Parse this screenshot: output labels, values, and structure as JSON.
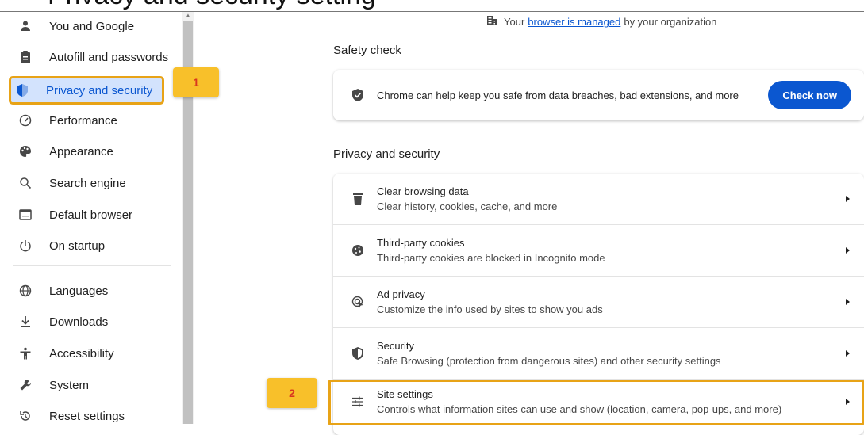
{
  "top_heading": "Privacy and security setting",
  "sidebar": {
    "items": [
      {
        "label": "You and Google",
        "icon": "person-icon"
      },
      {
        "label": "Autofill and passwords",
        "icon": "clipboard-icon"
      },
      {
        "label": "Privacy and security",
        "icon": "shield-icon"
      },
      {
        "label": "Performance",
        "icon": "speedometer-icon"
      },
      {
        "label": "Appearance",
        "icon": "palette-icon"
      },
      {
        "label": "Search engine",
        "icon": "search-icon"
      },
      {
        "label": "Default browser",
        "icon": "browser-window-icon"
      },
      {
        "label": "On startup",
        "icon": "power-icon"
      },
      {
        "label": "Languages",
        "icon": "globe-icon"
      },
      {
        "label": "Downloads",
        "icon": "download-icon"
      },
      {
        "label": "Accessibility",
        "icon": "accessibility-icon"
      },
      {
        "label": "System",
        "icon": "wrench-icon"
      },
      {
        "label": "Reset settings",
        "icon": "reset-icon"
      }
    ]
  },
  "badges": {
    "one": "1",
    "two": "2"
  },
  "managed_notice": {
    "prefix": "Your",
    "link": "browser is managed",
    "suffix": "by your organization"
  },
  "safety_check": {
    "title": "Safety check",
    "description": "Chrome can help keep you safe from data breaches, bad extensions, and more",
    "button": "Check now"
  },
  "privacy_section": {
    "title": "Privacy and security",
    "rows": [
      {
        "title": "Clear browsing data",
        "subtitle": "Clear history, cookies, cache, and more",
        "icon": "trash-icon"
      },
      {
        "title": "Third-party cookies",
        "subtitle": "Third-party cookies are blocked in Incognito mode",
        "icon": "cookie-icon"
      },
      {
        "title": "Ad privacy",
        "subtitle": "Customize the info used by sites to show you ads",
        "icon": "ad-privacy-icon"
      },
      {
        "title": "Security",
        "subtitle": "Safe Browsing (protection from dangerous sites) and other security settings",
        "icon": "shield-icon"
      },
      {
        "title": "Site settings",
        "subtitle": "Controls what information sites can use and show (location, camera, pop-ups, and more)",
        "icon": "sliders-icon"
      }
    ]
  },
  "colors": {
    "accent": "#0b57d0",
    "highlight": "#e8a317",
    "badge": "#f8c02a",
    "active_bg": "#d3e3fd"
  }
}
